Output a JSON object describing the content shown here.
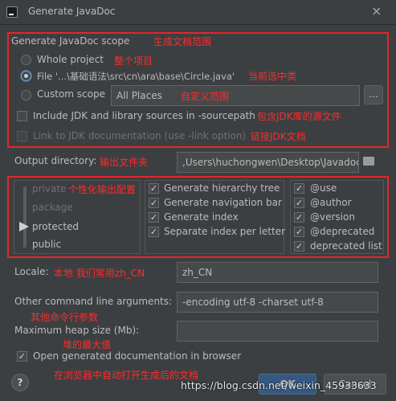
{
  "window": {
    "title": "Generate JavaDoc",
    "close_glyph": "×"
  },
  "scope": {
    "heading": "Generate JavaDoc scope",
    "heading_note": "生成文档范围",
    "whole_project": "Whole project",
    "whole_project_note": "整个项目",
    "file": "File '...\\基础语法\\src\\cn\\ara\\base\\Circle.java'",
    "file_note": "当前选中类",
    "custom_scope": "Custom scope",
    "custom_scope_value": "All Places",
    "custom_scope_note": "自定义范围",
    "browse_label": "...",
    "include_jdk": "Include JDK and library sources in -sourcepath",
    "include_jdk_note": "包含JDK库的源文件",
    "link_jdk": "Link to JDK documentation (use -link option)",
    "link_jdk_note": "链接JDK文档"
  },
  "output": {
    "label": "Output directory:",
    "note": "输出文件夹",
    "value": ",Users\\huchongwen\\Desktop\\Javadoc"
  },
  "visibility": {
    "note": "个性化输出配置",
    "levels": [
      "private",
      "package",
      "protected",
      "public"
    ],
    "selected": "protected"
  },
  "options_mid": [
    "Generate hierarchy tree",
    "Generate navigation bar",
    "Generate index",
    "Separate index per letter"
  ],
  "options_right": [
    "@use",
    "@author",
    "@version",
    "@deprecated",
    "deprecated list"
  ],
  "locale": {
    "label": "Locale:",
    "note": "本地 我们常用zh_CN",
    "value": "zh_CN"
  },
  "cmdline": {
    "label": "Other command line arguments:",
    "note": "其他命令行参数",
    "value": "-encoding utf-8 -charset utf-8"
  },
  "heap": {
    "label": "Maximum heap size (Mb):",
    "note": "堆的最大值",
    "value": ""
  },
  "open_browser": {
    "label": "Open generated documentation in browser",
    "note": "在浏览器中自动打开生成后的文档"
  },
  "footer": {
    "help": "?",
    "ok": "OK",
    "cancel": "Cancel",
    "watermark": "https://blog.csdn.net/weixin_45933633"
  },
  "colors": {
    "annotation": "#ff2b2b",
    "box": "#e5262a",
    "bg": "#3c3f41"
  },
  "icons": [
    "app-icon",
    "close-icon",
    "folder-icon",
    "help-icon"
  ]
}
